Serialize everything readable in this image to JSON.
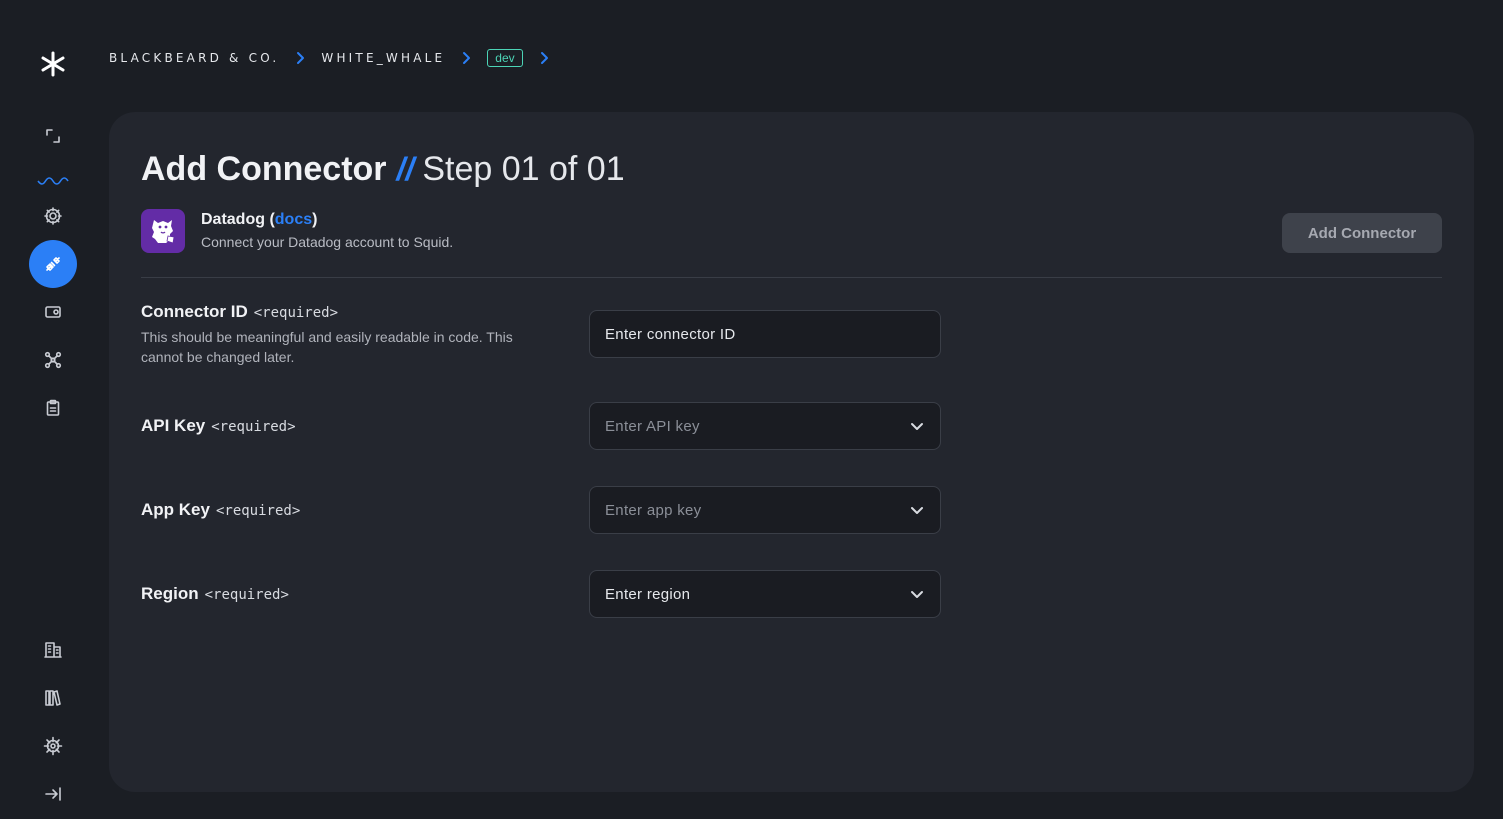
{
  "breadcrumb": {
    "org": "BLACKBEARD & CO.",
    "project": "WHITE_WHALE",
    "environment": "dev"
  },
  "sidebar": {
    "top_items": [
      {
        "icon": "asterisk-logo-icon"
      },
      {
        "icon": "expand-icon"
      },
      {
        "icon": "gear-icon"
      },
      {
        "icon": "plug-connector-icon",
        "active": true
      },
      {
        "icon": "wallet-icon"
      },
      {
        "icon": "network-nodes-icon"
      },
      {
        "icon": "clipboard-icon"
      }
    ],
    "bottom_items": [
      {
        "icon": "building-icon"
      },
      {
        "icon": "library-icon"
      },
      {
        "icon": "helm-icon"
      },
      {
        "icon": "collapse-sidebar-icon"
      }
    ]
  },
  "page": {
    "title": "Add Connector",
    "separator": "//",
    "step": "Step 01 of 01"
  },
  "connector": {
    "name": "Datadog",
    "docs_label": "docs",
    "description": "Connect your Datadog account to Squid.",
    "logo_color": "#632ca6"
  },
  "actions": {
    "add_label": "Add Connector"
  },
  "form": {
    "required_tag": "<required>",
    "connector_id": {
      "label": "Connector ID",
      "help": "This should be meaningful and easily readable in code. This cannot be changed later.",
      "placeholder": "Enter connector ID"
    },
    "api_key": {
      "label": "API Key",
      "placeholder": "Enter API key"
    },
    "app_key": {
      "label": "App Key",
      "placeholder": "Enter app key"
    },
    "region": {
      "label": "Region",
      "placeholder": "Enter region"
    }
  },
  "colors": {
    "accent": "#2b7ff6",
    "env_badge": "#4cd4b6",
    "background": "#1b1e24",
    "card": "#23262e"
  }
}
